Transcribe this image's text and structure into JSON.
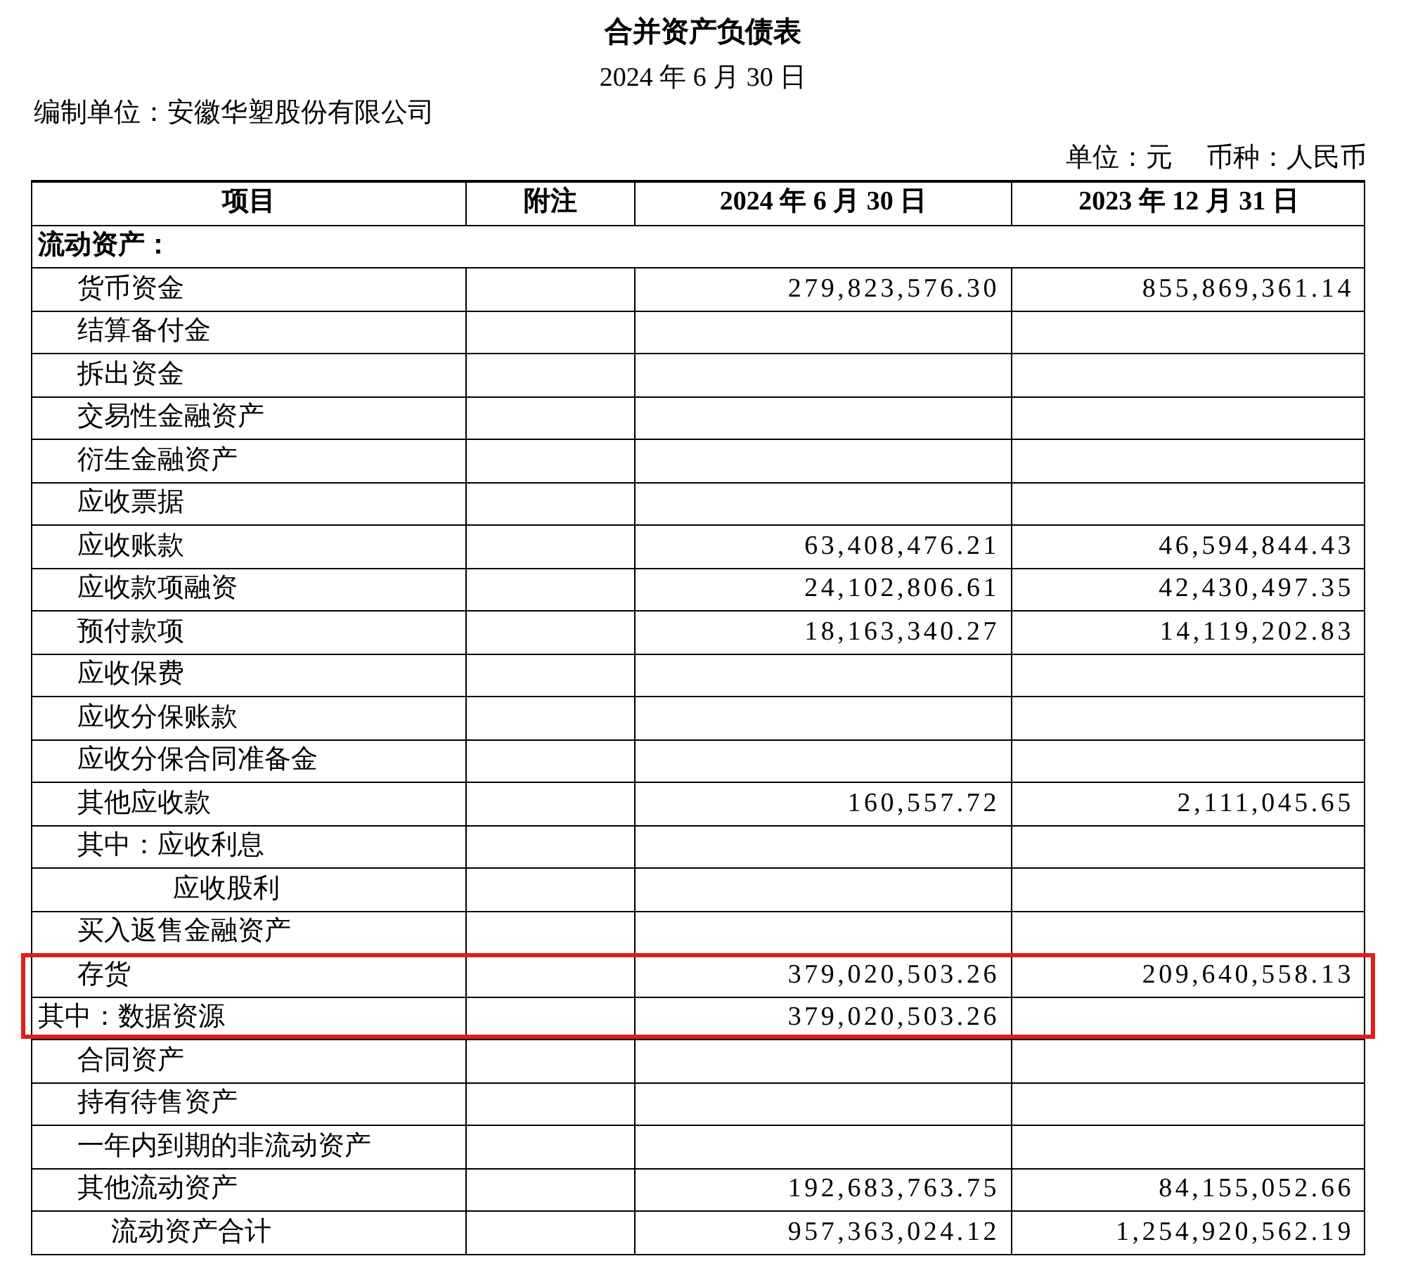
{
  "title": "合并资产负债表",
  "date": "2024 年 6 月 30 日",
  "company": "编制单位：安徽华塑股份有限公司",
  "unit": "单位：元",
  "currency": "币种：人民币",
  "columns": [
    "项目",
    "附注",
    "2024 年 6 月 30 日",
    "2023 年 12 月 31 日"
  ],
  "rows": [
    {
      "kind": "section",
      "item": "流动资产：",
      "note": "",
      "current": "",
      "previous": "",
      "highlighted": false
    },
    {
      "kind": "item",
      "item": "货币资金",
      "note": "",
      "current": "279,823,576.30",
      "previous": "855,869,361.14",
      "highlighted": false
    },
    {
      "kind": "item",
      "item": "结算备付金",
      "note": "",
      "current": "",
      "previous": "",
      "highlighted": false
    },
    {
      "kind": "item",
      "item": "拆出资金",
      "note": "",
      "current": "",
      "previous": "",
      "highlighted": false
    },
    {
      "kind": "item",
      "item": "交易性金融资产",
      "note": "",
      "current": "",
      "previous": "",
      "highlighted": false
    },
    {
      "kind": "item",
      "item": "衍生金融资产",
      "note": "",
      "current": "",
      "previous": "",
      "highlighted": false
    },
    {
      "kind": "item",
      "item": "应收票据",
      "note": "",
      "current": "",
      "previous": "",
      "highlighted": false
    },
    {
      "kind": "item",
      "item": "应收账款",
      "note": "",
      "current": "63,408,476.21",
      "previous": "46,594,844.43",
      "highlighted": false
    },
    {
      "kind": "item",
      "item": "应收款项融资",
      "note": "",
      "current": "24,102,806.61",
      "previous": "42,430,497.35",
      "highlighted": false
    },
    {
      "kind": "item",
      "item": "预付款项",
      "note": "",
      "current": "18,163,340.27",
      "previous": "14,119,202.83",
      "highlighted": false
    },
    {
      "kind": "item",
      "item": "应收保费",
      "note": "",
      "current": "",
      "previous": "",
      "highlighted": false
    },
    {
      "kind": "item",
      "item": "应收分保账款",
      "note": "",
      "current": "",
      "previous": "",
      "highlighted": false
    },
    {
      "kind": "item",
      "item": "应收分保合同准备金",
      "note": "",
      "current": "",
      "previous": "",
      "highlighted": false
    },
    {
      "kind": "item",
      "item": "其他应收款",
      "note": "",
      "current": "160,557.72",
      "previous": "2,111,045.65",
      "highlighted": false
    },
    {
      "kind": "item",
      "item": "其中：应收利息",
      "note": "",
      "current": "",
      "previous": "",
      "highlighted": false
    },
    {
      "kind": "sub",
      "item": "应收股利",
      "note": "",
      "current": "",
      "previous": "",
      "highlighted": false
    },
    {
      "kind": "item",
      "item": "买入返售金融资产",
      "note": "",
      "current": "",
      "previous": "",
      "highlighted": false
    },
    {
      "kind": "item",
      "item": "存货",
      "note": "",
      "current": "379,020,503.26",
      "previous": "209,640,558.13",
      "highlighted": true
    },
    {
      "kind": "flush",
      "item": "其中：数据资源",
      "note": "",
      "current": "379,020,503.26",
      "previous": "",
      "highlighted": true
    },
    {
      "kind": "item",
      "item": "合同资产",
      "note": "",
      "current": "",
      "previous": "",
      "highlighted": false
    },
    {
      "kind": "item",
      "item": "持有待售资产",
      "note": "",
      "current": "",
      "previous": "",
      "highlighted": false
    },
    {
      "kind": "item",
      "item": "一年内到期的非流动资产",
      "note": "",
      "current": "",
      "previous": "",
      "highlighted": false
    },
    {
      "kind": "item",
      "item": "其他流动资产",
      "note": "",
      "current": "192,683,763.75",
      "previous": "84,155,052.66",
      "highlighted": false
    },
    {
      "kind": "total",
      "item": "流动资产合计",
      "note": "",
      "current": "957,363,024.12",
      "previous": "1,254,920,562.19",
      "highlighted": false
    }
  ]
}
